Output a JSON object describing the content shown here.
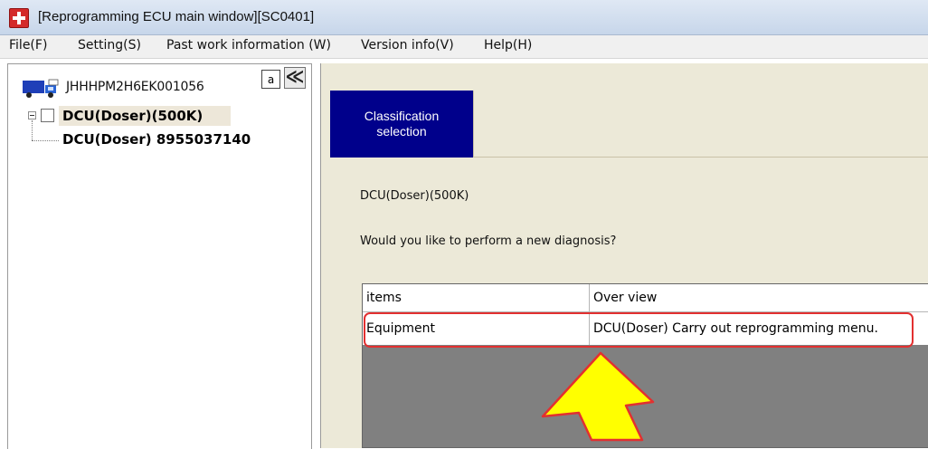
{
  "window": {
    "title": "[Reprogramming ECU main window][SC0401]"
  },
  "menu": {
    "items": [
      "File(F)",
      "Setting(S)",
      "Past work information (W)",
      "Version info(V)",
      "Help(H)"
    ]
  },
  "left_panel": {
    "vin": "JHHHPM2H6EK001056",
    "btn_a": "a",
    "btn_collapse": "≪",
    "tree_root": "DCU(Doser)(500K)",
    "tree_child": "DCU(Doser) 8955037140"
  },
  "right_panel": {
    "tab_label_line1": "Classification",
    "tab_label_line2": "selection",
    "content_title": "DCU(Doser)(500K)",
    "question": "Would you like to perform a new diagnosis?",
    "table": {
      "columns": [
        "items",
        "Over view"
      ],
      "rows": [
        [
          "Equipment",
          "DCU(Doser) Carry out reprogramming menu."
        ]
      ]
    }
  },
  "icons": {
    "app": "app-icon",
    "truck": "truck-icon",
    "arrow": "annotation-arrow-icon"
  },
  "colors": {
    "tab_active": "#00008b",
    "highlight": "#e23030",
    "arrow_fill": "#ffff00",
    "arrow_stroke": "#e23030"
  }
}
